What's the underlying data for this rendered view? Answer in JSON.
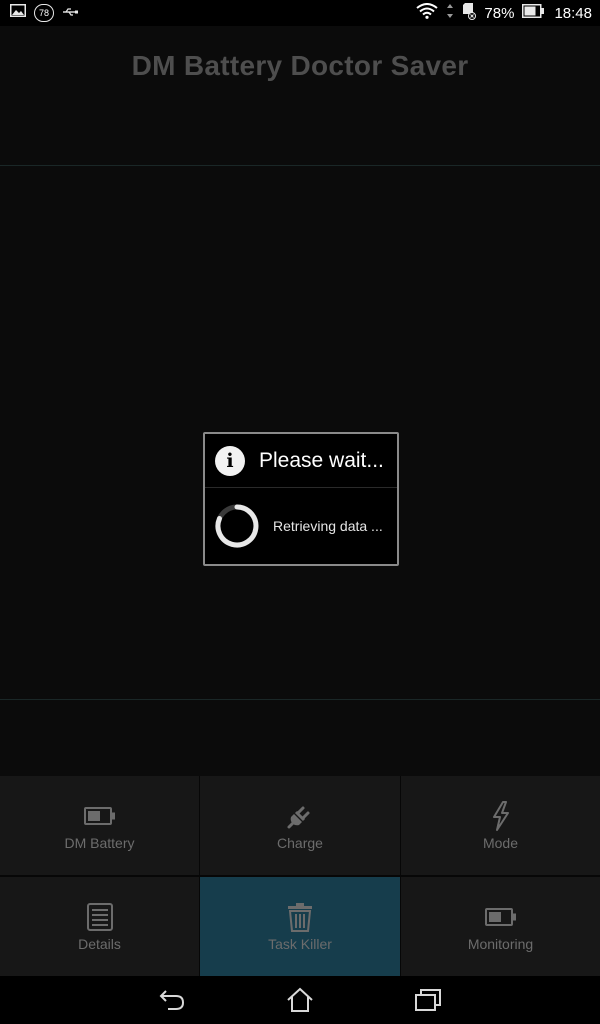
{
  "status_bar": {
    "notification_badge": "78",
    "battery_percent": "78%",
    "time": "18:48",
    "icons": [
      "image-icon",
      "badge-icon",
      "usb-icon",
      "wifi-icon",
      "data-arrows-icon",
      "sd-card-icon",
      "battery-icon"
    ]
  },
  "app": {
    "title": "DM Battery Doctor Saver"
  },
  "dialog": {
    "title": "Please wait...",
    "message": "Retrieving data ...",
    "icon": "info-icon"
  },
  "menu": {
    "items": [
      {
        "label": "DM Battery",
        "icon": "battery-icon",
        "active": false
      },
      {
        "label": "Charge",
        "icon": "plug-icon",
        "active": false
      },
      {
        "label": "Mode",
        "icon": "lightning-icon",
        "active": false
      },
      {
        "label": "Details",
        "icon": "list-icon",
        "active": false
      },
      {
        "label": "Task Killer",
        "icon": "trash-icon",
        "active": true
      },
      {
        "label": "Monitoring",
        "icon": "battery-monitor-icon",
        "active": false
      }
    ]
  },
  "nav": {
    "icons": [
      "back-icon",
      "home-icon",
      "recents-icon"
    ]
  },
  "colors": {
    "background": "#0b0b0b",
    "menu_background": "#171717",
    "active_tab": "#163d4c",
    "muted_text": "#6c6c6c",
    "title_text": "#4e4e4e"
  }
}
